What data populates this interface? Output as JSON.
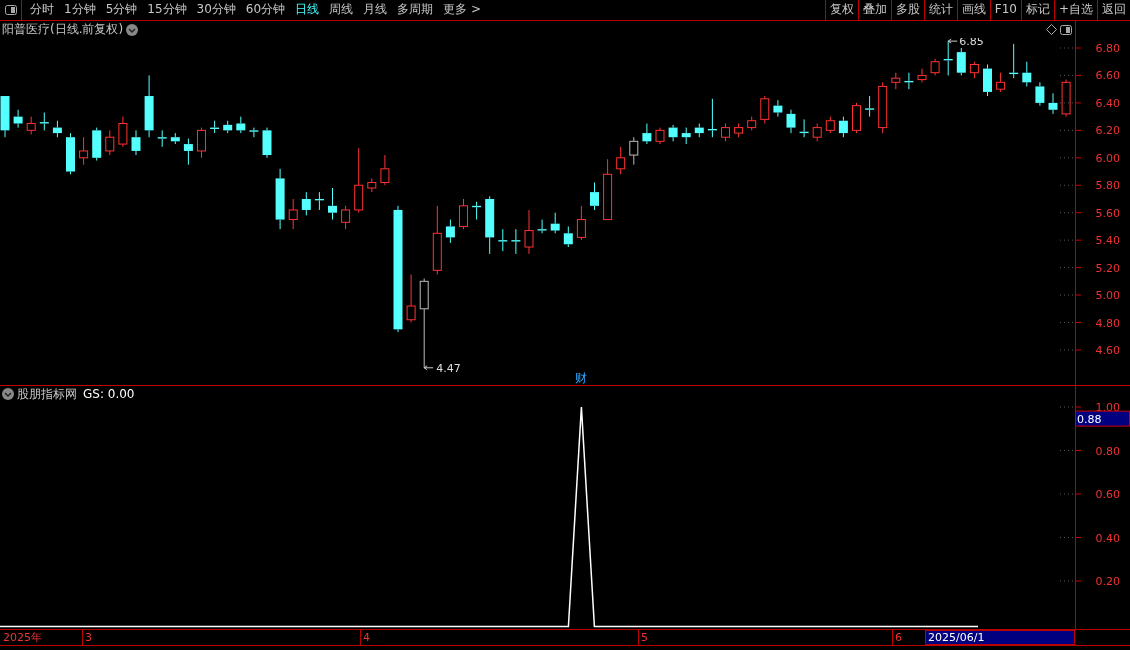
{
  "toolbar": {
    "periods": [
      {
        "label": "分时",
        "selected": false
      },
      {
        "label": "1分钟",
        "selected": false
      },
      {
        "label": "5分钟",
        "selected": false
      },
      {
        "label": "15分钟",
        "selected": false
      },
      {
        "label": "30分钟",
        "selected": false
      },
      {
        "label": "60分钟",
        "selected": false
      },
      {
        "label": "日线",
        "selected": true
      },
      {
        "label": "周线",
        "selected": false
      },
      {
        "label": "月线",
        "selected": false
      },
      {
        "label": "多周期",
        "selected": false
      },
      {
        "label": "更多 >",
        "selected": false
      }
    ],
    "actions": [
      "复权",
      "叠加",
      "多股",
      "统计",
      "画线",
      "F10",
      "标记",
      "+自选",
      "返回"
    ]
  },
  "price_panel": {
    "title": "阳普医疗(日线.前复权)",
    "y_ticks": [
      "6.80",
      "6.60",
      "6.40",
      "6.20",
      "6.00",
      "5.80",
      "5.60",
      "5.40",
      "5.20",
      "5.00",
      "4.80",
      "4.60"
    ],
    "high_label": "6.85",
    "low_label": "4.47",
    "event_marker": "财"
  },
  "indicator_panel": {
    "title": "股朋指标网",
    "reading": "GS: 0.00",
    "cursor_value": "0.88",
    "y_ticks": [
      "1.00",
      "0.80",
      "0.60",
      "0.40",
      "0.20"
    ]
  },
  "date_axis": {
    "labels": [
      "2025年",
      "3",
      "4",
      "5",
      "6"
    ],
    "cursor_date": "2025/06/1"
  }
}
